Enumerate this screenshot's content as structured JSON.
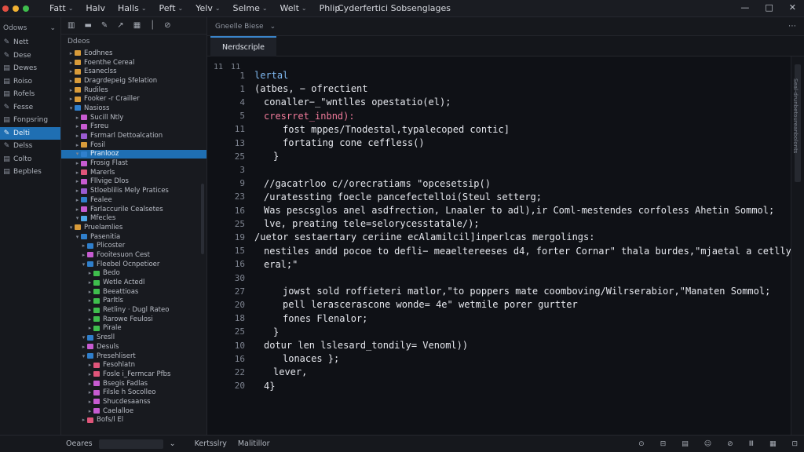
{
  "window": {
    "title": "Cyderfertici Sobsenglages",
    "traffic_colors": [
      "#e24f43",
      "#f2b233",
      "#3fbe4d"
    ],
    "controls": [
      "—",
      "□",
      "✕"
    ]
  },
  "menu": [
    {
      "label": "Fatt",
      "chev": "⌄"
    },
    {
      "label": "Halv",
      "chev": ""
    },
    {
      "label": "Halls",
      "chev": "⌄"
    },
    {
      "label": "Peft",
      "chev": "⌄"
    },
    {
      "label": "Yelv",
      "chev": "⌄"
    },
    {
      "label": "Selme",
      "chev": "⌄"
    },
    {
      "label": "Welt",
      "chev": "⌄"
    },
    {
      "label": "Phlip",
      "chev": ""
    }
  ],
  "activity": {
    "header": "Odows",
    "items": [
      {
        "label": "Nett",
        "icon": "✎"
      },
      {
        "label": "Dese",
        "icon": "✎"
      },
      {
        "label": "Dewes",
        "icon": "▤"
      },
      {
        "label": "Roiso",
        "icon": "▤"
      },
      {
        "label": "Rofels",
        "icon": "▤"
      },
      {
        "label": "Fesse",
        "icon": "✎"
      },
      {
        "label": "Fonpsring",
        "icon": "▤"
      },
      {
        "label": "Delti",
        "icon": "✎"
      },
      {
        "label": "Delss",
        "icon": "✎"
      },
      {
        "label": "Colto",
        "icon": "▤"
      },
      {
        "label": "Bepbles",
        "icon": "▤"
      }
    ]
  },
  "explorer": {
    "toolbar": [
      "▥",
      "▬",
      "✎",
      "↗",
      "▦",
      "│",
      "⊘"
    ],
    "header": "Ddeos",
    "rows": [
      {
        "label": "Eodhnes",
        "indent": 1,
        "twist": "▸",
        "color": "#d89b3a"
      },
      {
        "label": "Foenthe Cereal",
        "indent": 1,
        "twist": "▸",
        "color": "#d89b3a"
      },
      {
        "label": "Esaneclss",
        "indent": 1,
        "twist": "▸",
        "color": "#d89b3a"
      },
      {
        "label": "Dragrdepeig Sfelation",
        "indent": 1,
        "twist": "▸",
        "color": "#d89b3a"
      },
      {
        "label": "Rudiles",
        "indent": 1,
        "twist": "▸",
        "color": "#d89b3a"
      },
      {
        "label": "Fooker -r Crailler",
        "indent": 1,
        "twist": "▸",
        "color": "#d89b3a"
      },
      {
        "label": "Nasioss",
        "indent": 1,
        "twist": "▾",
        "color": "#2f7fcc"
      },
      {
        "label": "Sucill Ntly",
        "indent": 2,
        "twist": "▸",
        "color": "#c75bd1"
      },
      {
        "label": "Fsreu",
        "indent": 2,
        "twist": "▸",
        "color": "#c75bd1"
      },
      {
        "label": "Fsrmarl Dettoalcation",
        "indent": 2,
        "twist": "▸",
        "color": "#9a5bd1"
      },
      {
        "label": "Fosil",
        "indent": 2,
        "twist": "▸",
        "color": "#d89b3a"
      },
      {
        "label": "Pranlooz",
        "indent": 2,
        "twist": "▾",
        "color": "#2f7fcc",
        "selected": true
      },
      {
        "label": "Frosig Flast",
        "indent": 2,
        "twist": "▸",
        "color": "#c75bd1"
      },
      {
        "label": "Marerls",
        "indent": 2,
        "twist": "▸",
        "color": "#e0557a"
      },
      {
        "label": "Fllvige Dlos",
        "indent": 2,
        "twist": "▸",
        "color": "#c75bd1"
      },
      {
        "label": "Stloeblilis Mely Pratices",
        "indent": 2,
        "twist": "▸",
        "color": "#9a5bd1"
      },
      {
        "label": "Fealee",
        "indent": 2,
        "twist": "▸",
        "color": "#2f7fcc"
      },
      {
        "label": "Farlaccurile Cealsetes",
        "indent": 2,
        "twist": "▸",
        "color": "#c75bd1"
      },
      {
        "label": "Mfecles",
        "indent": 2,
        "twist": "▾",
        "color": "#4ea8e8"
      },
      {
        "label": "Pruelamlies",
        "indent": 1,
        "twist": "▾",
        "color": "#d89b3a"
      },
      {
        "label": "Pasenitia",
        "indent": 2,
        "twist": "▾",
        "color": "#2f7fcc"
      },
      {
        "label": "Plicoster",
        "indent": 3,
        "twist": "▸",
        "color": "#2f7fcc"
      },
      {
        "label": "Fooitesuon Cest",
        "indent": 3,
        "twist": "▸",
        "color": "#c75bd1"
      },
      {
        "label": "Fleebel Ocnpetioer",
        "indent": 3,
        "twist": "▾",
        "color": "#2f7fcc"
      },
      {
        "label": "Bedo",
        "indent": 4,
        "twist": "▸",
        "color": "#3fbe4d"
      },
      {
        "label": "Wetle Actedl",
        "indent": 4,
        "twist": "▸",
        "color": "#3fbe4d"
      },
      {
        "label": "Beeattioas",
        "indent": 4,
        "twist": "▸",
        "color": "#3fbe4d"
      },
      {
        "label": "Parltls",
        "indent": 4,
        "twist": "▸",
        "color": "#3fbe4d"
      },
      {
        "label": "Retliny · Dugl Rateo",
        "indent": 4,
        "twist": "▸",
        "color": "#3fbe4d"
      },
      {
        "label": "Rarowe Feulosi",
        "indent": 4,
        "twist": "▸",
        "color": "#3fbe4d"
      },
      {
        "label": "Pirale",
        "indent": 4,
        "twist": "▸",
        "color": "#3fbe4d"
      },
      {
        "label": "Sresll",
        "indent": 3,
        "twist": "▾",
        "color": "#2f7fcc"
      },
      {
        "label": "Desuls",
        "indent": 3,
        "twist": "▸",
        "color": "#c75bd1"
      },
      {
        "label": "Presehlisert",
        "indent": 3,
        "twist": "▾",
        "color": "#2f7fcc"
      },
      {
        "label": "Fesohlatn",
        "indent": 4,
        "twist": "▸",
        "color": "#e0557a"
      },
      {
        "label": "Fosle i_Fermcar Pfbs",
        "indent": 4,
        "twist": "▸",
        "color": "#e0557a"
      },
      {
        "label": "Bsegis Fadlas",
        "indent": 4,
        "twist": "▸",
        "color": "#c75bd1"
      },
      {
        "label": "Filsle h Socolleo",
        "indent": 4,
        "twist": "▸",
        "color": "#c75bd1"
      },
      {
        "label": "Shucdesaanss",
        "indent": 4,
        "twist": "▸",
        "color": "#c75bd1"
      },
      {
        "label": "Caelalloe",
        "indent": 4,
        "twist": "▸",
        "color": "#c75bd1"
      },
      {
        "label": "Bofs/l El",
        "indent": 3,
        "twist": "▸",
        "color": "#e0557a"
      }
    ]
  },
  "editor": {
    "search_tab": "Gneelle Biese",
    "search_chev": "⌄",
    "more": "⋯",
    "file_tab": "Nerdscriple",
    "gutter_marks": [
      "11",
      "11"
    ],
    "lines": [
      {
        "n": "1",
        "text": "lertal",
        "color": "#7fb8f0",
        "indent": 0
      },
      {
        "n": "1",
        "text": "(atbes, − ofrectient",
        "color": "#e6e8ee",
        "indent": 0
      },
      {
        "n": "4",
        "text": "conaller−_\"wntlles opestatio(el);",
        "color": "#e6e8ee",
        "indent": 1
      },
      {
        "n": "5",
        "text": "cresrret_inbnd):",
        "color": "#f07a9a",
        "indent": 1
      },
      {
        "n": "11",
        "text": "fost mppes/Tnodestal,typalecoped contic]",
        "color": "#e6e8ee",
        "indent": 3
      },
      {
        "n": "13",
        "text": "fortating cone ceffless()",
        "color": "#e6e8ee",
        "indent": 3
      },
      {
        "n": "25",
        "text": "}",
        "color": "#e6e8ee",
        "indent": 2
      },
      {
        "n": "3",
        "text": "",
        "color": "#e6e8ee",
        "indent": 0
      },
      {
        "n": "9",
        "text": "//gacatrloo c//orecratiams \"opcesetsip()",
        "color": "#e6e8ee",
        "indent": 1
      },
      {
        "n": "23",
        "text": "/uratessting foecle pancefectelloi(Steul setterg;",
        "color": "#e6e8ee",
        "indent": 1
      },
      {
        "n": "16",
        "text": "Was pescsglos anel asdfrection, Lnaaler to adl),ir Coml-mestendes corfoless Ahetin Sommol;",
        "color": "#e6e8ee",
        "indent": 1
      },
      {
        "n": "25",
        "text": "lve, preating tele=selorycesstatale/);",
        "color": "#e6e8ee",
        "indent": 1
      },
      {
        "n": "19",
        "text": "/uetor sestaertary ceriine ecAlamilcil]inperlcas mergolings:",
        "color": "#e6e8ee",
        "indent": 0
      },
      {
        "n": "15",
        "text": "nestiles andd pocoe to defli− meaeltereeses d4, forter Cornar\" thala burdes,\"mjaetal a cetlly",
        "color": "#e6e8ee",
        "indent": 1
      },
      {
        "n": "16",
        "text": "eral;\"",
        "color": "#e6e8ee",
        "indent": 1
      },
      {
        "n": "30",
        "text": "",
        "color": "#e6e8ee",
        "indent": 0
      },
      {
        "n": "27",
        "text": "jowst sold roffieteri matlor,\"to poppers mate coomboving/Wilrserabior,\"Manaten Sommol;",
        "color": "#e6e8ee",
        "indent": 3
      },
      {
        "n": "20",
        "text": "pell lerascerascone wonde= 4e\" wetmile porer gurtter",
        "color": "#e6e8ee",
        "indent": 3
      },
      {
        "n": "18",
        "text": "fones Flenalor;",
        "color": "#e6e8ee",
        "indent": 3
      },
      {
        "n": "25",
        "text": "}",
        "color": "#e6e8ee",
        "indent": 2
      },
      {
        "n": "10",
        "text": "dotur len lslesard_tondily= Venoml))",
        "color": "#e6e8ee",
        "indent": 1
      },
      {
        "n": "16",
        "text": "lonaces };",
        "color": "#e6e8ee",
        "indent": 3
      },
      {
        "n": "22",
        "text": "lever,",
        "color": "#e6e8ee",
        "indent": 2
      },
      {
        "n": "20",
        "text": "4}",
        "color": "#e6e8ee",
        "indent": 1
      }
    ],
    "scroll_text": "Seal-drunbetoureanbolonts"
  },
  "status": {
    "left_label": "Oeares",
    "mid": [
      "Kertsslry",
      "Malitillor"
    ],
    "right": [
      "⊙",
      "⊟",
      "▤",
      "☺",
      "⊘",
      "Ⅲ",
      "▦",
      "⊡"
    ]
  }
}
